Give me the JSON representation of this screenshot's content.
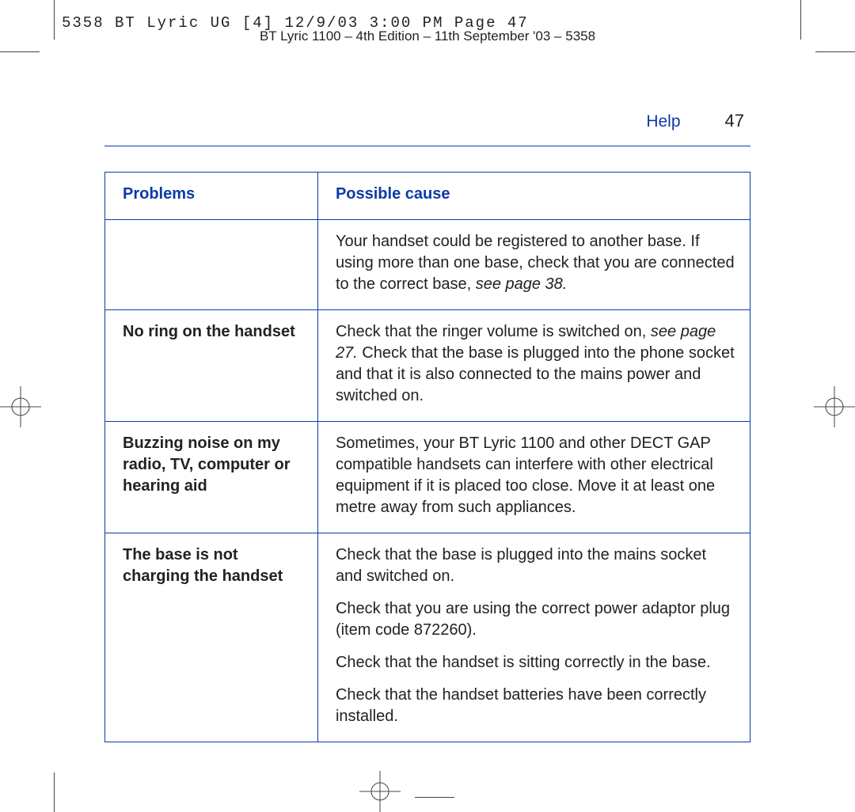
{
  "slug": "5358 BT Lyric UG [4]  12/9/03  3:00 PM  Page 47",
  "edition": "BT Lyric 1100 – 4th Edition – 11th September '03 – 5358",
  "header": {
    "section": "Help",
    "page": "47"
  },
  "table": {
    "columns": {
      "problem": "Problems",
      "cause": "Possible cause"
    },
    "rows": [
      {
        "problem": "",
        "cause_pre": "Your handset could be registered to another base. If using more than one base, check that you are connected to the correct base, ",
        "cause_italic": "see page 38.",
        "cause_post": ""
      },
      {
        "problem": "No ring on the handset",
        "cause_pre": "Check that the ringer volume is switched on, ",
        "cause_italic": "see page 27.",
        "cause_post": " Check that the base is plugged into the phone socket and that it is also connected to the mains power and switched on."
      },
      {
        "problem": "Buzzing noise on my radio, TV, computer or hearing aid",
        "cause_pre": "Sometimes, your BT Lyric 1100 and other DECT GAP compatible handsets can interfere with other electrical equipment if it is placed too close. Move it at least one metre away from such appliances.",
        "cause_italic": "",
        "cause_post": ""
      },
      {
        "problem": "The base is not charging the handset",
        "cause_paragraphs": [
          "Check that the base is plugged into the mains socket and switched on.",
          "Check that you are using the correct power adaptor plug (item code 872260).",
          "Check that the handset is sitting correctly in the base.",
          "Check that the handset batteries have been correctly installed."
        ]
      }
    ]
  }
}
